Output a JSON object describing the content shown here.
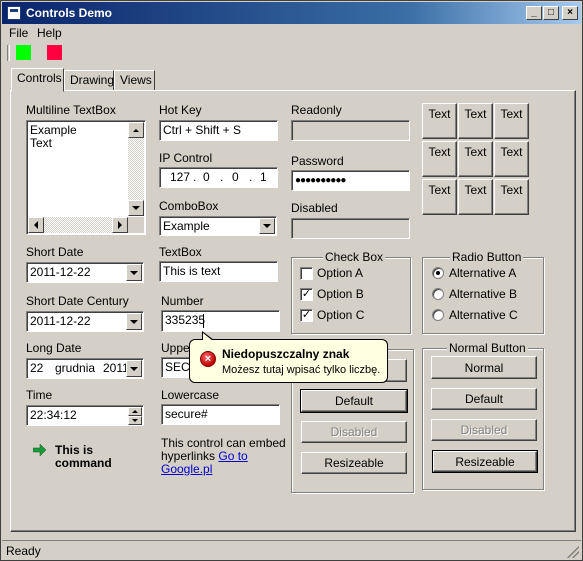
{
  "window": {
    "title": "Controls Demo"
  },
  "menu": {
    "file": "File",
    "help": "Help"
  },
  "toolbar": {
    "green_color": "#00ff00",
    "red_color": "#ff0040"
  },
  "tabs": [
    {
      "label": "Controls"
    },
    {
      "label": "Drawing"
    },
    {
      "label": "Views"
    }
  ],
  "multiline": {
    "label": "Multiline TextBox",
    "lines": [
      "Example",
      "Text"
    ]
  },
  "hotkey": {
    "label": "Hot Key",
    "value": "Ctrl + Shift + S"
  },
  "ip": {
    "label": "IP Control",
    "octets": [
      "127",
      "0",
      "0",
      "1"
    ]
  },
  "combobox": {
    "label": "ComboBox",
    "value": "Example"
  },
  "short_date": {
    "label": "Short Date",
    "value": "2011-12-22"
  },
  "short_date_century": {
    "label": "Short Date Century",
    "value": "2011-12-22"
  },
  "long_date": {
    "label": "Long Date",
    "day": "22",
    "month": "grudnia",
    "year": "2011"
  },
  "time": {
    "label": "Time",
    "value": "22:34:12"
  },
  "command": {
    "line1": "This is",
    "line2": "command"
  },
  "textbox": {
    "label": "TextBox",
    "value": "This is text"
  },
  "number": {
    "label": "Number",
    "value": "335235"
  },
  "uppercase": {
    "label": "Uppercase",
    "label_visible": "Upper",
    "value": "SECU"
  },
  "lowercase": {
    "label": "Lowercase",
    "value": "secure#"
  },
  "hyperlink_text": {
    "line1": "This control can embed",
    "line2_prefix": "hyperlinks ",
    "link_part1": "Go to",
    "link_part2": "Google.pl"
  },
  "readonly": {
    "label": "Readonly",
    "value": ""
  },
  "password": {
    "label": "Password",
    "value": "●●●●●●●●●●"
  },
  "disabled_field": {
    "label": "Disabled",
    "value": ""
  },
  "grid": {
    "cells": [
      "Text",
      "Text",
      "Text",
      "Text",
      "Text",
      "Text",
      "Text",
      "Text",
      "Text"
    ]
  },
  "checkbox_group": {
    "title": "Check Box",
    "items": [
      {
        "label": "Option A",
        "checked": false
      },
      {
        "label": "Option B",
        "checked": true
      },
      {
        "label": "Option C",
        "checked": true
      }
    ]
  },
  "radio_group": {
    "title": "Radio Button",
    "items": [
      {
        "label": "Alternative A",
        "checked": true
      },
      {
        "label": "Alternative B",
        "checked": false
      },
      {
        "label": "Alternative C",
        "checked": false
      }
    ]
  },
  "flat_buttons": {
    "default": "Default",
    "disabled": "Disabled",
    "resizeable": "Resizeable"
  },
  "normal_buttons": {
    "title": "Normal Button",
    "normal": "Normal",
    "default": "Default",
    "disabled": "Disabled",
    "resizeable": "Resizeable"
  },
  "tooltip": {
    "title": "Niedopuszczalny znak",
    "message": "Możesz tutaj wpisać tylko liczbę."
  },
  "status": {
    "text": "Ready"
  }
}
